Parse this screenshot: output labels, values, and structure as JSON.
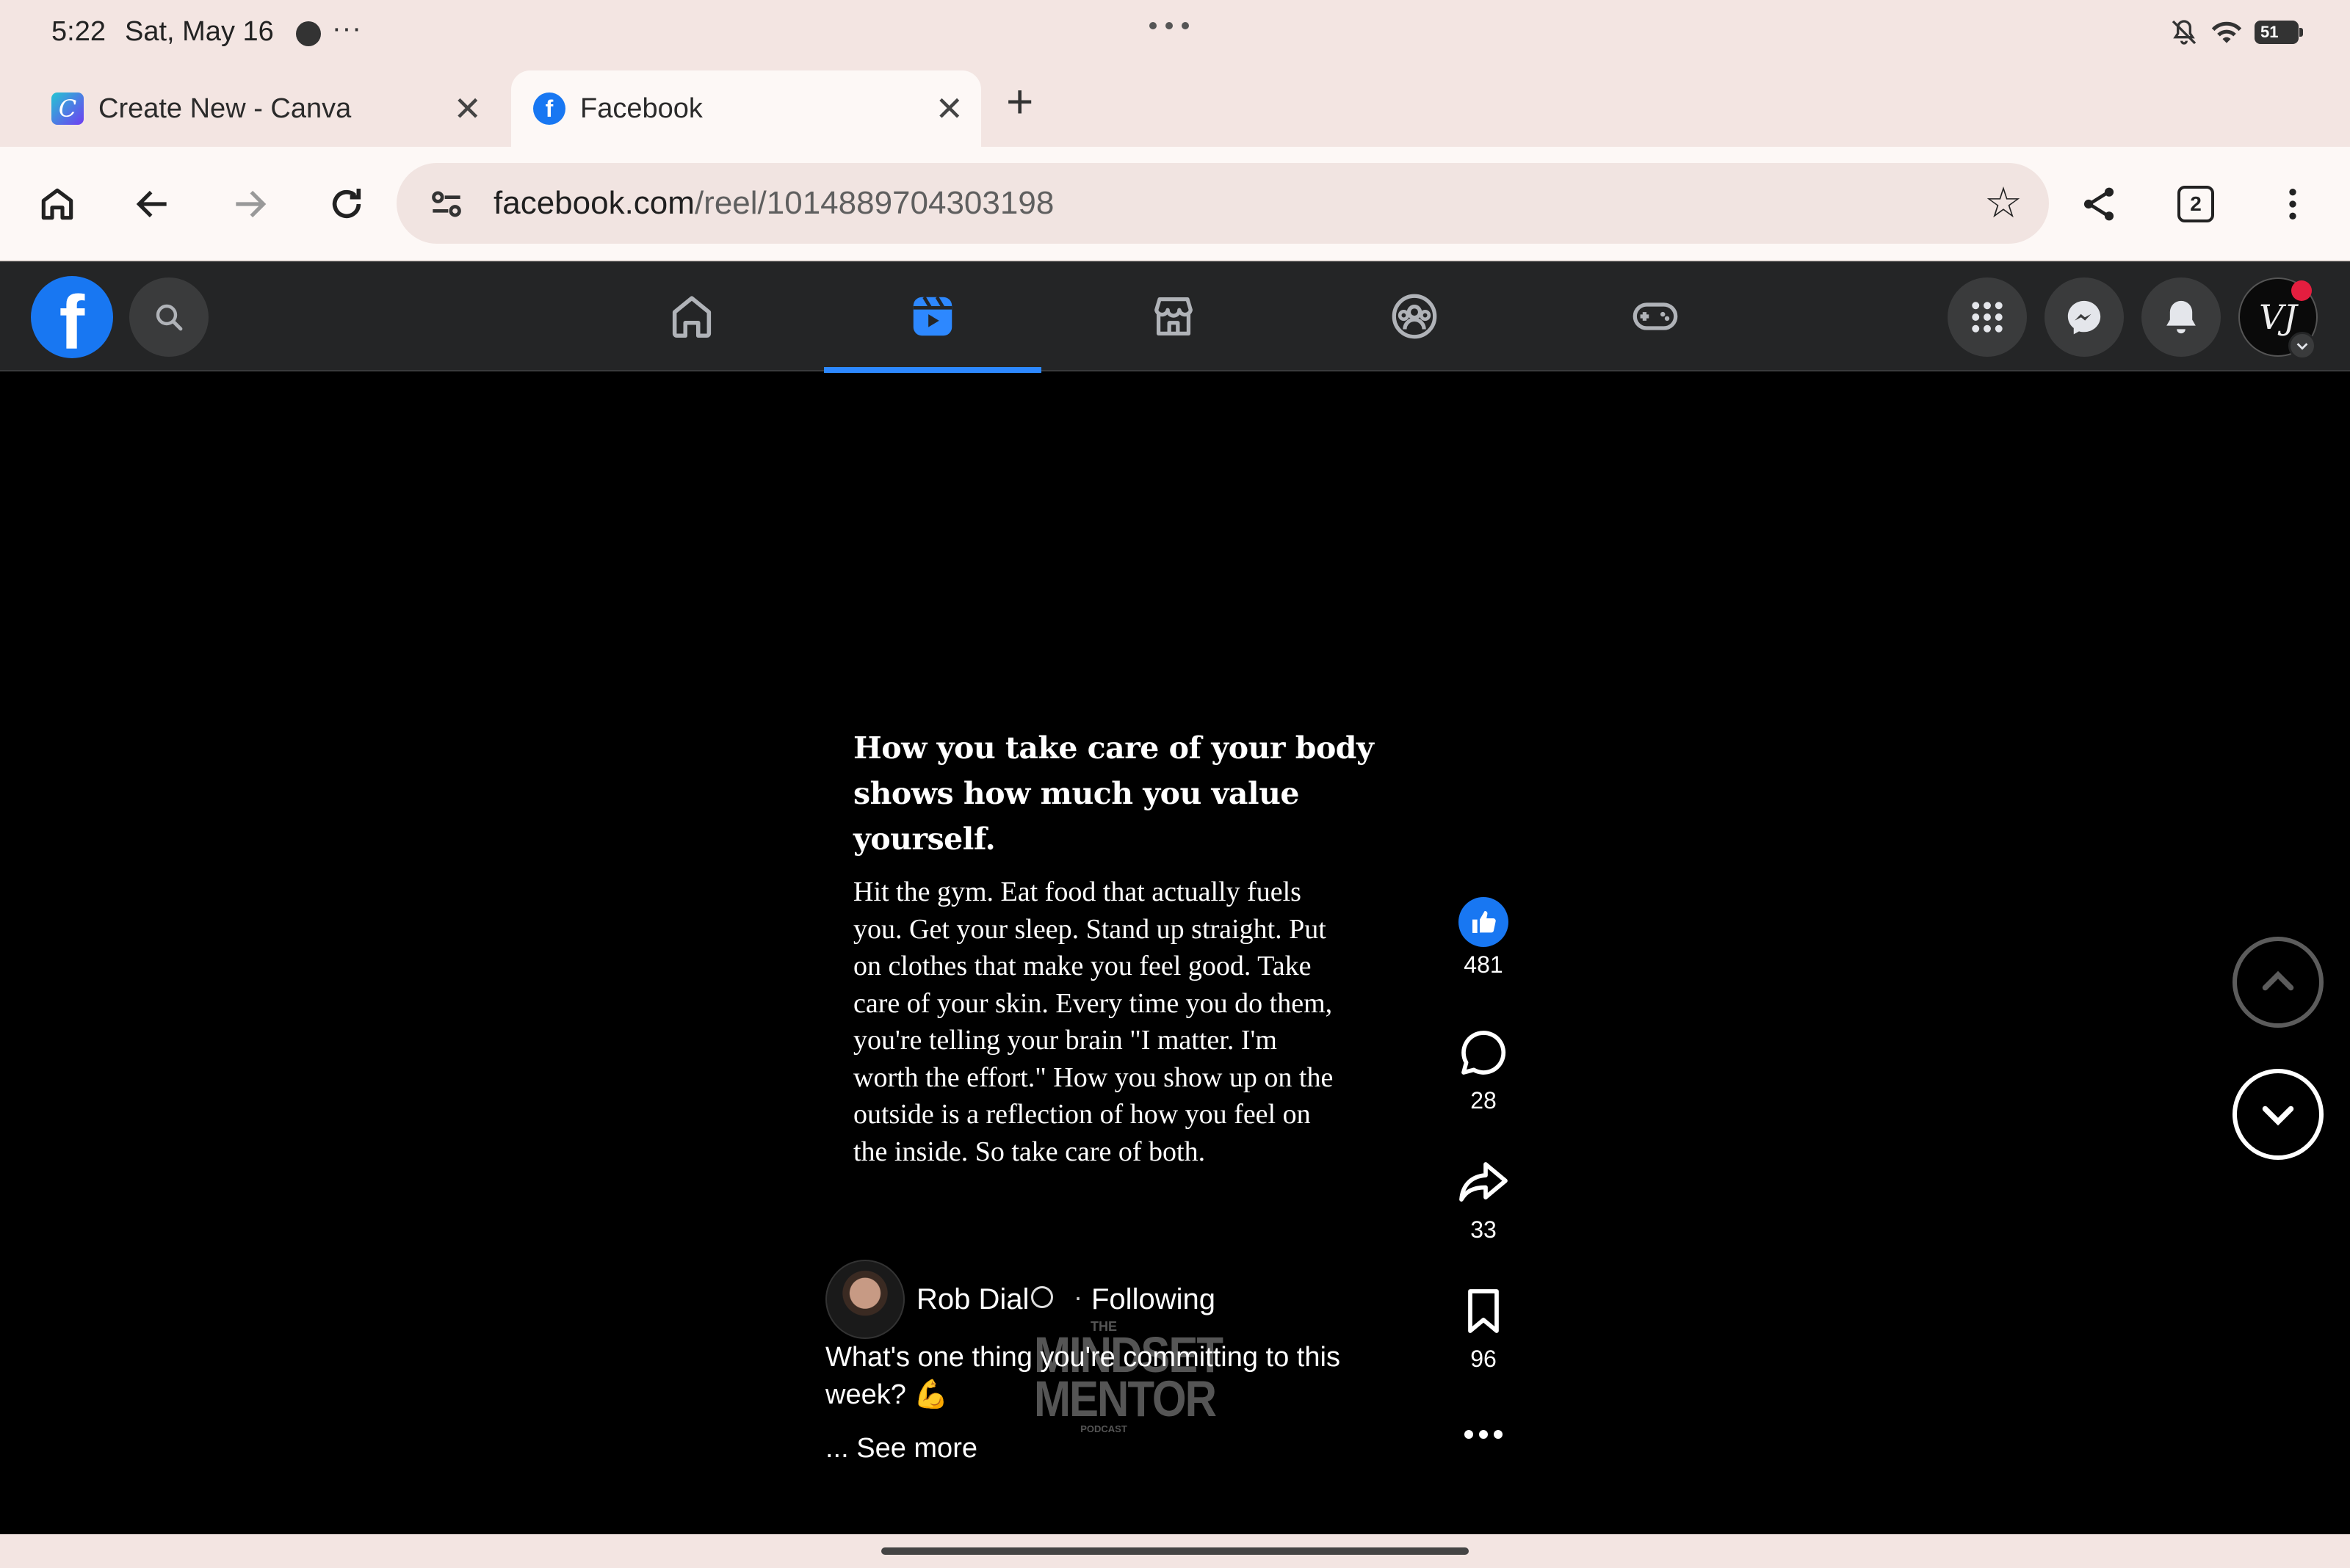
{
  "status_bar": {
    "time": "5:22",
    "date": "Sat, May 16",
    "more": "···",
    "battery": "51"
  },
  "tabs": [
    {
      "title": "Create New - Canva",
      "favicon": "C",
      "active": false
    },
    {
      "title": "Facebook",
      "favicon": "f",
      "active": true
    }
  ],
  "toolbar": {
    "url_host": "facebook.com",
    "url_path": "/reel/1014889704303198",
    "tab_count": "2"
  },
  "facebook_nav": {
    "logo": "f",
    "active_item": "reels",
    "items": [
      "home",
      "reels",
      "marketplace",
      "groups",
      "gaming"
    ],
    "profile_initials": "VJ",
    "colors": {
      "accent": "#2d88ff",
      "brand": "#1877f2",
      "nav_bg": "#242526"
    }
  },
  "reel": {
    "headline": "How you take care of your body\nshows how much you value yourself.",
    "body": "Hit the gym. Eat food that actually fuels\nyou. Get your sleep. Stand up straight. Put\non clothes that make you feel good. Take\ncare of your skin.  Every time you do them,\nyou're telling your brain \"I matter. I'm\nworth the effort.\" How you show up on the\noutside is a reflection of how you feel on\nthe inside. So take care of both.",
    "watermark": {
      "top": "THE",
      "line1": "MINDSET",
      "line2": "MENTOR",
      "bottom": "PODCAST"
    },
    "author": "Rob Dial",
    "separator": "·",
    "follow_status": "Following",
    "caption": "What's one thing you're committing to this week? 💪",
    "see_more": "... See more",
    "actions": {
      "likes": "481",
      "comments": "28",
      "shares": "33",
      "saves": "96"
    }
  }
}
